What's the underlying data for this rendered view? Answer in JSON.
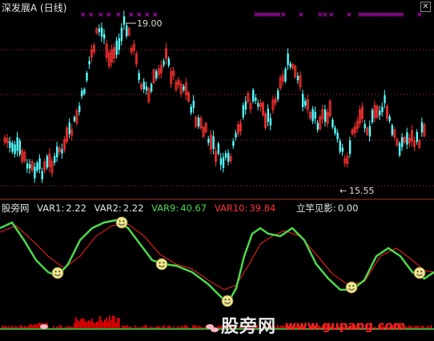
{
  "main": {
    "title": "深发展A",
    "period": "(日线)",
    "high_label": "19.00",
    "low_label": "15.55",
    "low_arrow": "←"
  },
  "indicator": {
    "source": "股旁网",
    "var1_label": "VAR1:",
    "var1_value": "2.22",
    "var2_label": "VAR2:",
    "var2_value": "2.22",
    "var9_label": "VAR9:",
    "var9_value": "40.67",
    "var10_label": "VAR10:",
    "var10_value": "39.84",
    "lgjy_label": "立竿见影:",
    "lgjy_value": "0.00"
  },
  "watermark": {
    "text": "股旁网",
    "url": "www.gupang.com"
  },
  "colors": {
    "background": "#000000",
    "candle_up": "#ff3232",
    "candle_down": "#54ffff",
    "x_marker": "#ff00ff",
    "var9_line": "#4cd94c",
    "var10_line": "#ff2222",
    "histogram": "#ff0000",
    "grid": "#a03030"
  },
  "icons": {
    "smiley": "smiley-face-icon",
    "close": "close-icon",
    "marker": "x-marker-icon"
  },
  "chart_data": {
    "type": "candlestick",
    "price_high": 19.0,
    "price_low": 15.55,
    "indicator_type": "line",
    "series": [
      {
        "name": "VAR9",
        "value": 40.67
      },
      {
        "name": "VAR10",
        "value": 39.84
      }
    ]
  }
}
